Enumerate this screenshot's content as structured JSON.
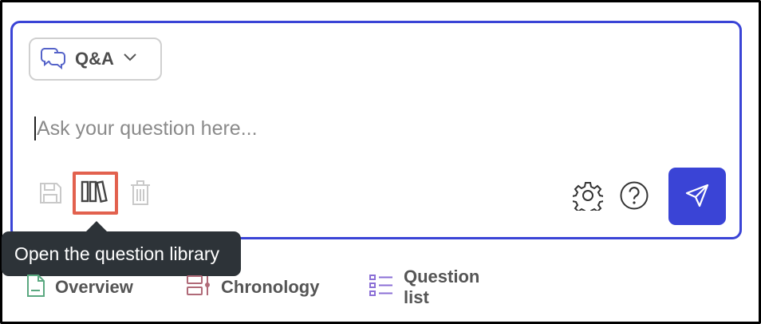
{
  "mode_select": {
    "label": "Q&A",
    "icon": "chat-bubbles-icon"
  },
  "question": {
    "placeholder": "Ask your question here...",
    "value": ""
  },
  "toolbar": {
    "save_icon": "save-icon",
    "library_icon": "books-icon",
    "delete_icon": "trash-icon",
    "settings_icon": "gear-icon",
    "help_icon": "help-circle-icon",
    "send_icon": "send-icon"
  },
  "tooltip": {
    "text": "Open the question library"
  },
  "tabs": [
    {
      "label": "Overview",
      "icon": "document-icon"
    },
    {
      "label": "Chronology",
      "icon": "timeline-icon"
    },
    {
      "label": "Question list",
      "icon": "list-icon"
    }
  ],
  "colors": {
    "accent": "#3a44d6",
    "highlight": "#e2614e",
    "tooltip_bg": "#2d3338",
    "overview_icon": "#5aa880",
    "chronology_icon": "#b06a78",
    "question_list_icon": "#8b6fd6"
  }
}
